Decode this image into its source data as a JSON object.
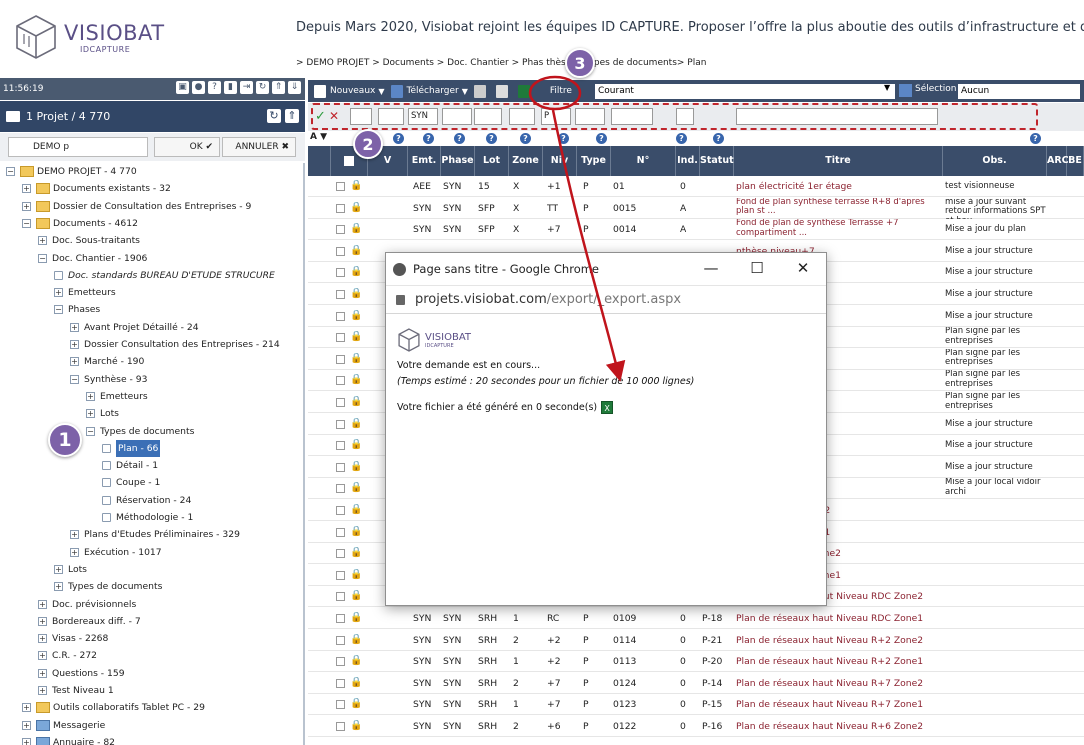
{
  "header": {
    "logo_text": "VISIOBAT",
    "logo_sub": "IDCAPTURE",
    "tagline": "Depuis Mars 2020, Visiobat rejoint les équipes ID CAPTURE. Proposer l’offre la plus aboutie des outils d’infrastructure et de con",
    "breadcrumb": "> DEMO PROJET > Documents > Doc. Chantier > Phas     thèse > Types de documents> Plan"
  },
  "left": {
    "time": "11:56:19",
    "project": "1 Projet / 4 770",
    "search_value": "DEMO p",
    "ok_label": "OK ✔",
    "cancel_label": "ANNULER ✖",
    "tree": [
      {
        "label": "DEMO PROJET - 4 770",
        "level": 0,
        "pm": "−",
        "icon": "folder"
      },
      {
        "label": "Documents existants - 32",
        "level": 1,
        "pm": "+",
        "icon": "folder"
      },
      {
        "label": "Dossier de Consultation des Entreprises - 9",
        "level": 1,
        "pm": "+",
        "icon": "folder"
      },
      {
        "label": "Documents - 4612",
        "level": 1,
        "pm": "−",
        "icon": "folder"
      },
      {
        "label": "Doc. Sous-traitants",
        "level": 2,
        "pm": "+",
        "icon": ""
      },
      {
        "label": "Doc. Chantier - 1906",
        "level": 2,
        "pm": "−",
        "icon": ""
      },
      {
        "label": "Doc. standards BUREAU D'ETUDE STRUCURE",
        "level": 3,
        "pm": "",
        "icon": "doc",
        "italic": true
      },
      {
        "label": "Emetteurs",
        "level": 3,
        "pm": "+",
        "icon": ""
      },
      {
        "label": "Phases",
        "level": 3,
        "pm": "−",
        "icon": ""
      },
      {
        "label": "Avant Projet Détaillé - 24",
        "level": 4,
        "pm": "+",
        "icon": ""
      },
      {
        "label": "Dossier Consultation des Entreprises - 214",
        "level": 4,
        "pm": "+",
        "icon": ""
      },
      {
        "label": "Marché - 190",
        "level": 4,
        "pm": "+",
        "icon": ""
      },
      {
        "label": "Synthèse - 93",
        "level": 4,
        "pm": "−",
        "icon": ""
      },
      {
        "label": "Emetteurs",
        "level": 5,
        "pm": "+",
        "icon": ""
      },
      {
        "label": "Lots",
        "level": 5,
        "pm": "+",
        "icon": ""
      },
      {
        "label": "Types de documents",
        "level": 5,
        "pm": "−",
        "icon": ""
      },
      {
        "label": "Plan - 66",
        "level": 6,
        "pm": "",
        "icon": "doc",
        "selected": true
      },
      {
        "label": "Détail - 1",
        "level": 6,
        "pm": "",
        "icon": "doc"
      },
      {
        "label": "Coupe - 1",
        "level": 6,
        "pm": "",
        "icon": "doc"
      },
      {
        "label": "Réservation - 24",
        "level": 6,
        "pm": "",
        "icon": "doc"
      },
      {
        "label": "Méthodologie - 1",
        "level": 6,
        "pm": "",
        "icon": "doc"
      },
      {
        "label": "Plans d'Etudes Préliminaires - 329",
        "level": 4,
        "pm": "+",
        "icon": ""
      },
      {
        "label": "Exécution - 1017",
        "level": 4,
        "pm": "+",
        "icon": ""
      },
      {
        "label": "Lots",
        "level": 3,
        "pm": "+",
        "icon": ""
      },
      {
        "label": "Types de documents",
        "level": 3,
        "pm": "+",
        "icon": ""
      },
      {
        "label": "Doc. prévisionnels",
        "level": 2,
        "pm": "+",
        "icon": ""
      },
      {
        "label": "Bordereaux diff. - 7",
        "level": 2,
        "pm": "+",
        "icon": ""
      },
      {
        "label": "Visas - 2268",
        "level": 2,
        "pm": "+",
        "icon": ""
      },
      {
        "label": "C.R. - 272",
        "level": 2,
        "pm": "+",
        "icon": ""
      },
      {
        "label": "Questions - 159",
        "level": 2,
        "pm": "+",
        "icon": ""
      },
      {
        "label": "Test Niveau 1",
        "level": 2,
        "pm": "+",
        "icon": ""
      },
      {
        "label": "Outils collaboratifs Tablet PC - 29",
        "level": 1,
        "pm": "+",
        "icon": "folder"
      },
      {
        "label": "Messagerie",
        "level": 1,
        "pm": "+",
        "icon": "folderblue"
      },
      {
        "label": "Annuaire - 82",
        "level": 1,
        "pm": "+",
        "icon": "folderblue"
      },
      {
        "label": "Profil et Autres",
        "level": 1,
        "pm": "+",
        "icon": "folder"
      }
    ]
  },
  "toolbar": {
    "nouveaux": "Nouveaux",
    "telecharger": "Télécharger",
    "filtre_label": "Filtre",
    "filtre_value": "Courant",
    "selection_label": "Sélection",
    "selection_value": "Aucun"
  },
  "filters": [
    "",
    "",
    "SYN",
    "",
    "",
    "",
    "P",
    "",
    "",
    "",
    ""
  ],
  "table": {
    "headers": [
      "V",
      "Emt.",
      "Phase",
      "Lot",
      "Zone",
      "Niv",
      "Type",
      "N°",
      "Ind.",
      "Statut",
      "Titre",
      "Obs.",
      "ARC",
      "BE"
    ],
    "rows": [
      {
        "emt": "AEE",
        "phase": "SYN",
        "lot": "15",
        "zone": "X",
        "niv": "+1",
        "type": "P",
        "num": "01",
        "ind": "0",
        "statut": "",
        "titre": "plan électricité 1er étage",
        "obs": "test visionneuse"
      },
      {
        "emt": "SYN",
        "phase": "SYN",
        "lot": "SFP",
        "zone": "X",
        "niv": "TT",
        "type": "P",
        "num": "0015",
        "ind": "A",
        "statut": "",
        "titre": "Fond de plan synthèse terrasse R+8 d'apres plan st ...",
        "obs": "mise à jour suivant retour informations SPT et hau ..."
      },
      {
        "emt": "SYN",
        "phase": "SYN",
        "lot": "SFP",
        "zone": "X",
        "niv": "+7",
        "type": "P",
        "num": "0014",
        "ind": "A",
        "statut": "",
        "titre": "Fond de plan de synthèse Terrasse +7 compartiment ...",
        "obs": "Mise a jour du plan"
      },
      {
        "emt": "",
        "phase": "",
        "lot": "",
        "zone": "",
        "niv": "",
        "type": "",
        "num": "",
        "ind": "",
        "statut": "",
        "titre": "nthèse niveau+7",
        "obs": "Mise a jour structure"
      },
      {
        "emt": "",
        "phase": "",
        "lot": "",
        "zone": "",
        "niv": "",
        "type": "",
        "num": "",
        "ind": "",
        "statut": "",
        "titre": "nthèse niveau+6",
        "obs": "Mise a jour structure"
      },
      {
        "emt": "",
        "phase": "",
        "lot": "",
        "zone": "",
        "niv": "",
        "type": "",
        "num": "",
        "ind": "",
        "statut": "",
        "titre": "nthèse niveau+5",
        "obs": "Mise a jour structure"
      },
      {
        "emt": "",
        "phase": "",
        "lot": "",
        "zone": "",
        "niv": "",
        "type": "",
        "num": "",
        "ind": "",
        "statut": "",
        "titre": "nthèse niveau+4",
        "obs": "Mise a jour structure"
      },
      {
        "emt": "",
        "phase": "",
        "lot": "",
        "zone": "",
        "niv": "",
        "type": "",
        "num": "",
        "ind": "",
        "statut": "",
        "titre": "E DES TERMINAUX",
        "obs": "Plan signé par les entreprises"
      },
      {
        "emt": "",
        "phase": "",
        "lot": "",
        "zone": "",
        "niv": "",
        "type": "",
        "num": "",
        "ind": "",
        "statut": "",
        "titre": "E DES TERMINAUX",
        "obs": "Plan signé par les entreprises"
      },
      {
        "emt": "",
        "phase": "",
        "lot": "",
        "zone": "",
        "niv": "",
        "type": "",
        "num": "",
        "ind": "",
        "statut": "",
        "titre": "E DES TERMINAUX",
        "obs": "Plan signé par les entreprises"
      },
      {
        "emt": "",
        "phase": "",
        "lot": "",
        "zone": "",
        "niv": "",
        "type": "",
        "num": "",
        "ind": "",
        "statut": "",
        "titre": "E DES TERMINAUX",
        "obs": "Plan signé par les entreprises"
      },
      {
        "emt": "",
        "phase": "",
        "lot": "",
        "zone": "",
        "niv": "",
        "type": "",
        "num": "",
        "ind": "",
        "statut": "",
        "titre": "nthèse niveau+3",
        "obs": "Mise a jour structure"
      },
      {
        "emt": "",
        "phase": "",
        "lot": "",
        "zone": "",
        "niv": "",
        "type": "",
        "num": "",
        "ind": "",
        "statut": "",
        "titre": "nthèse niveau+2",
        "obs": "Mise a jour structure"
      },
      {
        "emt": "",
        "phase": "",
        "lot": "",
        "zone": "",
        "niv": "",
        "type": "",
        "num": "",
        "ind": "",
        "statut": "",
        "titre": "nthèse niveau+1",
        "obs": "Mise a jour structure"
      },
      {
        "emt": "",
        "phase": "",
        "lot": "",
        "zone": "",
        "niv": "",
        "type": "",
        "num": "",
        "ind": "",
        "statut": "",
        "titre": "nthèse niveau RDC",
        "obs": "Mise a jour local vidoir archi"
      },
      {
        "emt": "",
        "phase": "",
        "lot": "",
        "zone": "",
        "niv": "",
        "type": "",
        "num": "",
        "ind": "",
        "statut": "",
        "titre": "aut Niveau -1 Zone2",
        "obs": ""
      },
      {
        "emt": "",
        "phase": "",
        "lot": "",
        "zone": "",
        "niv": "",
        "type": "",
        "num": "",
        "ind": "",
        "statut": "",
        "titre": "aut Niveau -1 Zone1",
        "obs": ""
      },
      {
        "emt": "",
        "phase": "",
        "lot": "",
        "zone": "",
        "niv": "",
        "type": "",
        "num": "",
        "ind": "",
        "statut": "",
        "titre": "aut Niveau R+1 Zone2",
        "obs": ""
      },
      {
        "emt": "",
        "phase": "",
        "lot": "",
        "zone": "",
        "niv": "",
        "type": "",
        "num": "",
        "ind": "",
        "statut": "",
        "titre": "aut Niveau R+1 Zone1",
        "obs": ""
      },
      {
        "emt": "SYN",
        "phase": "SYN",
        "lot": "SRH",
        "zone": "2",
        "niv": "RC",
        "type": "P",
        "num": "0110",
        "ind": "0",
        "statut": "P-21",
        "titre": "Plan de réseaux haut Niveau RDC Zone2",
        "obs": ""
      },
      {
        "emt": "SYN",
        "phase": "SYN",
        "lot": "SRH",
        "zone": "1",
        "niv": "RC",
        "type": "P",
        "num": "0109",
        "ind": "0",
        "statut": "P-18",
        "titre": "Plan de réseaux haut Niveau RDC Zone1",
        "obs": ""
      },
      {
        "emt": "SYN",
        "phase": "SYN",
        "lot": "SRH",
        "zone": "2",
        "niv": "+2",
        "type": "P",
        "num": "0114",
        "ind": "0",
        "statut": "P-21",
        "titre": "Plan de réseaux haut Niveau R+2 Zone2",
        "obs": ""
      },
      {
        "emt": "SYN",
        "phase": "SYN",
        "lot": "SRH",
        "zone": "1",
        "niv": "+2",
        "type": "P",
        "num": "0113",
        "ind": "0",
        "statut": "P-20",
        "titre": "Plan de réseaux haut Niveau R+2 Zone1",
        "obs": ""
      },
      {
        "emt": "SYN",
        "phase": "SYN",
        "lot": "SRH",
        "zone": "2",
        "niv": "+7",
        "type": "P",
        "num": "0124",
        "ind": "0",
        "statut": "P-14",
        "titre": "Plan de réseaux haut Niveau R+7 Zone2",
        "obs": ""
      },
      {
        "emt": "SYN",
        "phase": "SYN",
        "lot": "SRH",
        "zone": "1",
        "niv": "+7",
        "type": "P",
        "num": "0123",
        "ind": "0",
        "statut": "P-15",
        "titre": "Plan de réseaux haut Niveau R+7 Zone1",
        "obs": ""
      },
      {
        "emt": "SYN",
        "phase": "SYN",
        "lot": "SRH",
        "zone": "2",
        "niv": "+6",
        "type": "P",
        "num": "0122",
        "ind": "0",
        "statut": "P-16",
        "titre": "Plan de réseaux haut Niveau R+6 Zone2",
        "obs": ""
      }
    ]
  },
  "popup": {
    "window_title": "Page sans titre - Google Chrome",
    "url_host": "projets.visiobat.com",
    "url_path": "/export/_export.aspx",
    "line1": "Votre demande est en cours...",
    "line2": "(Temps estimé : 20 secondes pour un fichier de 10 000 lignes)",
    "line3": "Votre fichier a été généré en 0 seconde(s)",
    "logo_text": "VISIOBAT",
    "logo_sub": "IDCAPTURE"
  },
  "badges": [
    "1",
    "2",
    "3"
  ],
  "colors": {
    "accent": "#7d62a8",
    "header": "#3a4d6a",
    "dashed": "#c0262d",
    "title": "#8b2230",
    "arrow": "#c0141c"
  }
}
